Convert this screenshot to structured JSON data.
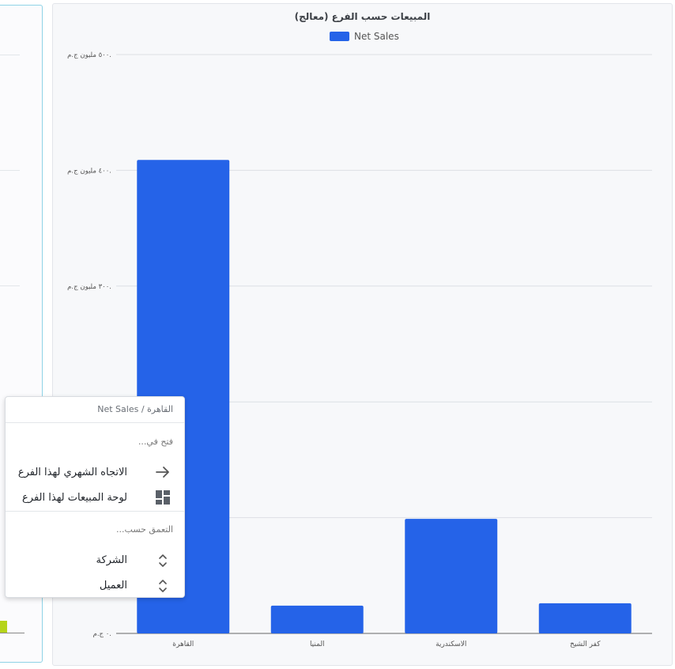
{
  "chart_data": {
    "type": "bar",
    "title": "المبيعات حسب الفرع (معالج)",
    "legend": "top-center",
    "categories": [
      "القاهرة",
      "المنيا",
      "الاسكندرية",
      "كفر الشيخ"
    ],
    "series": [
      {
        "name": "Net Sales",
        "color": "#2563e8",
        "values": [
          409,
          24,
          99,
          26
        ]
      }
    ],
    "ylim": [
      0,
      500
    ],
    "yticks": [
      0,
      100,
      200,
      300,
      400,
      500
    ],
    "ytick_labels": [
      "٠ ج.م.",
      "",
      "",
      "٣٠٠ مليون ج.م.",
      "٤٠٠ مليون ج.م.",
      "٥٠٠ مليون ج.م."
    ],
    "grid": true
  },
  "context_menu": {
    "header": "القاهرة / Net Sales",
    "open_in_label": "فتح في...",
    "open_items": [
      {
        "label": "الاتجاه الشهري لهذا الفرع",
        "icon": "arrow-right-icon"
      },
      {
        "label": "لوحة المبيعات لهذا الفرع",
        "icon": "dashboard-icon"
      }
    ],
    "drill_label": "التعمق حسب...",
    "drill_items": [
      {
        "label": "الشركة",
        "icon": "chevron-up-down-icon"
      },
      {
        "label": "العميل",
        "icon": "chevron-up-down-icon"
      }
    ]
  },
  "colors": {
    "bar": "#2563e8",
    "left_bar": "#b6d41b",
    "panel_border_left": "#8fd3e6"
  }
}
